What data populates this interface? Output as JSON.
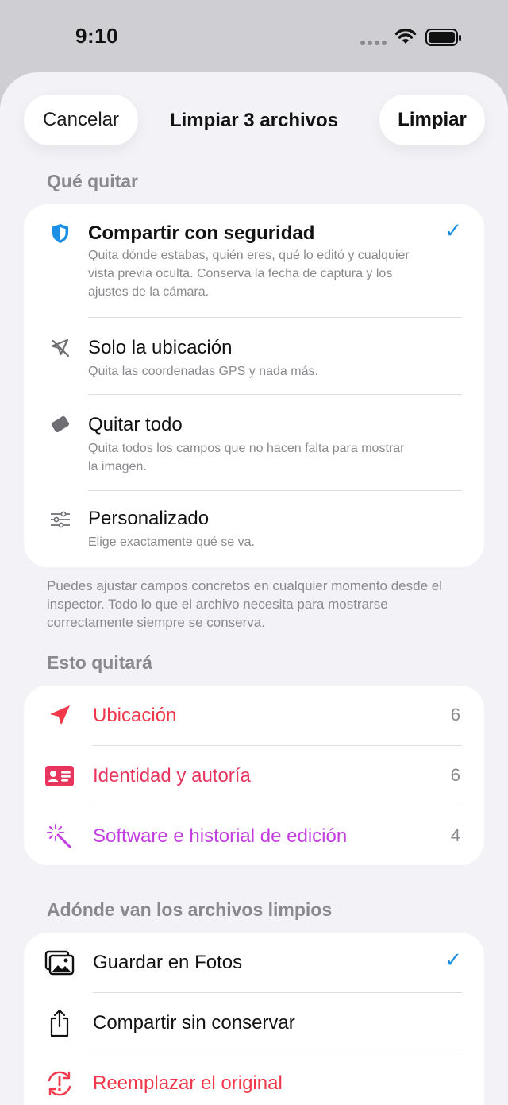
{
  "status_bar": {
    "time": "9:10"
  },
  "nav": {
    "cancel": "Cancelar",
    "title": "Limpiar 3 archivos",
    "confirm": "Limpiar"
  },
  "remove_section": {
    "header": "Qué quitar",
    "options": [
      {
        "icon": "shield-icon",
        "title": "Compartir con seguridad",
        "desc": "Quita dónde estabas, quién eres, qué lo editó y cualquier vista previa oculta. Conserva la fecha de captura y los ajustes de la cámara.",
        "selected": true
      },
      {
        "icon": "location-slash-icon",
        "title": "Solo la ubicación",
        "desc": "Quita las coordenadas GPS y nada más.",
        "selected": false
      },
      {
        "icon": "eraser-icon",
        "title": "Quitar todo",
        "desc": "Quita todos los campos que no hacen falta para mostrar la imagen.",
        "selected": false
      },
      {
        "icon": "sliders-icon",
        "title": "Personalizado",
        "desc": "Elige exactamente qué se va.",
        "selected": false
      }
    ],
    "footnote": "Puedes ajustar campos concretos en cualquier momento desde el inspector. Todo lo que el archivo necesita para mostrarse correctamente siempre se conserva."
  },
  "removes_section": {
    "header": "Esto quitará",
    "rows": [
      {
        "icon": "location-arrow-icon",
        "label": "Ubicación",
        "count": "6",
        "color": "#f0384a"
      },
      {
        "icon": "id-card-icon",
        "label": "Identidad y autoría",
        "count": "6",
        "color": "#e8355e"
      },
      {
        "icon": "magic-wand-icon",
        "label": "Software e historial de edición",
        "count": "4",
        "color": "#c23ee0"
      }
    ]
  },
  "destination_section": {
    "header": "Adónde van los archivos limpios",
    "rows": [
      {
        "icon": "photos-icon",
        "label": "Guardar en Fotos",
        "selected": true
      },
      {
        "icon": "share-icon",
        "label": "Compartir sin conservar",
        "selected": false
      },
      {
        "icon": "replace-warning-icon",
        "label": "Reemplazar el original",
        "color": "#f0384a"
      }
    ]
  },
  "accent_color": "#1a8fe3"
}
